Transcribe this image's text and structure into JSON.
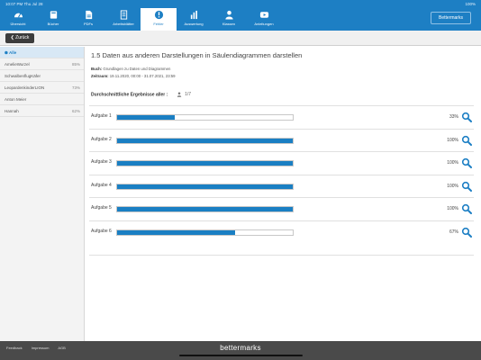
{
  "status": {
    "time": "10:07 PM",
    "date": "Thu Jul 28",
    "battery": "100%"
  },
  "nav": {
    "items": [
      {
        "label": "Übersicht",
        "icon": "dashboard-icon"
      },
      {
        "label": "Bücher",
        "icon": "book-icon"
      },
      {
        "label": "PDFs",
        "icon": "pdf-icon"
      },
      {
        "label": "Arbeitsblätter",
        "icon": "worksheet-icon"
      },
      {
        "label": "Fehler",
        "icon": "exclamation-icon"
      },
      {
        "label": "Auswertung",
        "icon": "bar-chart-icon"
      },
      {
        "label": "Klassen",
        "icon": "person-icon"
      },
      {
        "label": "Anleitungen",
        "icon": "youtube-icon"
      }
    ],
    "active_index": 4,
    "brand_button": "Bettermarks"
  },
  "toolbar": {
    "back_label": "Zurück"
  },
  "sidebar": {
    "items": [
      {
        "name": "Alle",
        "pct": ""
      },
      {
        "name": "AmelieWurzel",
        "pct": "85%"
      },
      {
        "name": "SchwalbenflugKäfer",
        "pct": ""
      },
      {
        "name": "LeopardenkinderLION",
        "pct": "73%"
      },
      {
        "name": "Anton Meier",
        "pct": ""
      },
      {
        "name": "Hannah",
        "pct": "62%"
      }
    ]
  },
  "main": {
    "title": "1.5 Daten aus anderen Darstellungen in Säulendiagrammen darstellen",
    "book_label": "Buch:",
    "book_value": "Grundlagen zu Daten und Diagrammen",
    "period_label": "Zeitraum:",
    "period_value": "19.11.2020, 00:00 - 31.07.2021, 23:59",
    "avg_label": "Durchschnittliche Ergebnisse aller :",
    "avg_count": "1/7",
    "tasks": [
      {
        "label": "Aufgabe 1",
        "value": 33,
        "pct_text": "33%"
      },
      {
        "label": "Aufgabe 2",
        "value": 100,
        "pct_text": "100%"
      },
      {
        "label": "Aufgabe 3",
        "value": 100,
        "pct_text": "100%"
      },
      {
        "label": "Aufgabe 4",
        "value": 100,
        "pct_text": "100%"
      },
      {
        "label": "Aufgabe 5",
        "value": 100,
        "pct_text": "100%"
      },
      {
        "label": "Aufgabe 6",
        "value": 67,
        "pct_text": "67%"
      }
    ]
  },
  "footer": {
    "links": [
      "Feedback",
      "Impressum",
      "AGB"
    ],
    "logo": "bettermarks"
  },
  "colors": {
    "primary": "#1d7fc4",
    "bar": "#1a7fc3",
    "footer": "#4a4a4a"
  }
}
